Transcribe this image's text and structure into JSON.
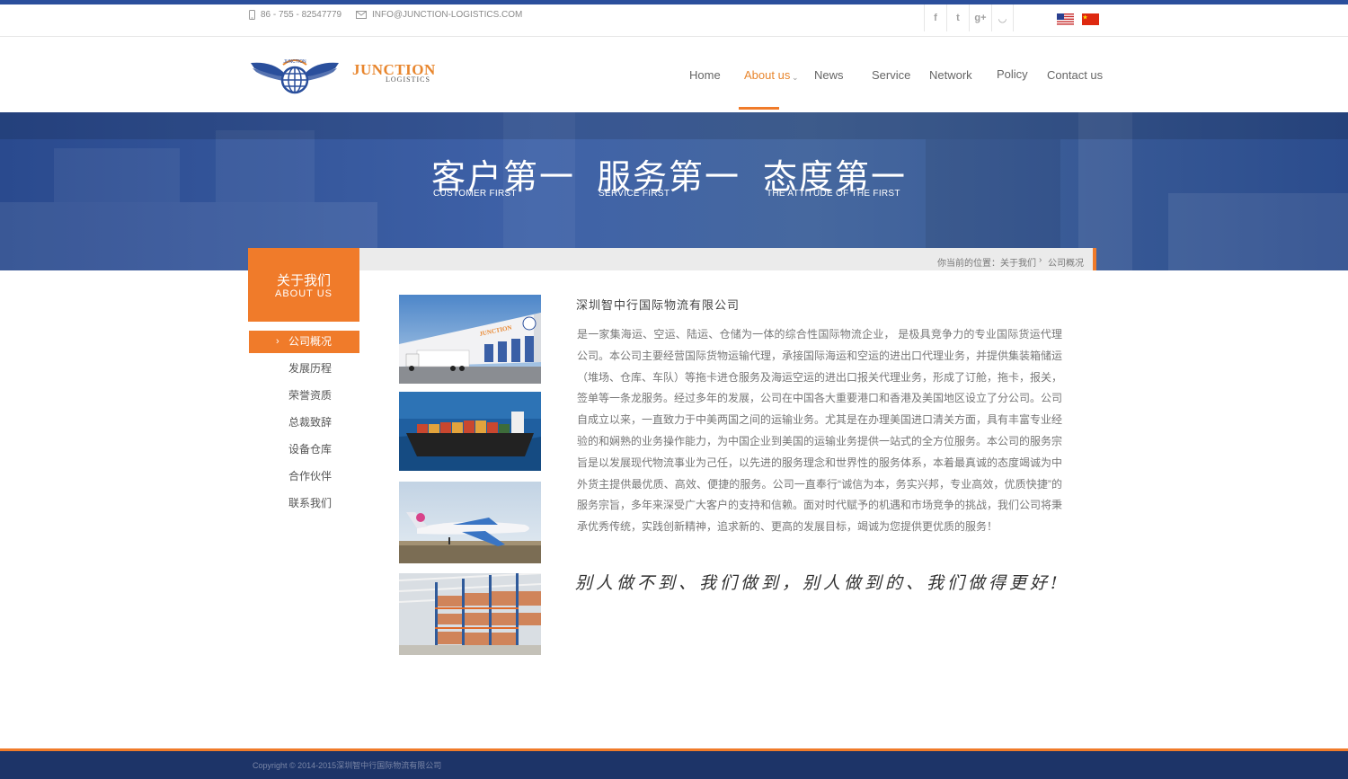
{
  "topbar": {
    "phone": "86 - 755 - 82547779",
    "email": "INFO@JUNCTION-LOGISTICS.COM",
    "socials": [
      {
        "icon": "facebook-icon",
        "glyph": "f"
      },
      {
        "icon": "twitter-icon",
        "glyph": "t"
      },
      {
        "icon": "google-plus-icon",
        "glyph": "g+"
      },
      {
        "icon": "rss-icon",
        "glyph": "◡"
      }
    ]
  },
  "logo": {
    "name": "JUNCTION",
    "sub": "LOGISTICS",
    "badge": "JUNCTION"
  },
  "nav": {
    "items": [
      {
        "label": "Home"
      },
      {
        "label": "About us",
        "active": true
      },
      {
        "label": "News"
      },
      {
        "label": "Service"
      },
      {
        "label": "Network"
      },
      {
        "label": "Policy"
      },
      {
        "label": "Contact us"
      }
    ]
  },
  "banner": {
    "slogans": [
      {
        "cn": "客户第一",
        "en": "CUSTOMER FIRST"
      },
      {
        "cn": "服务第一",
        "en": "SERVICE FIRST"
      },
      {
        "cn": "态度第一",
        "en": "THE ATTITUDE OF THE FIRST"
      }
    ]
  },
  "breadcrumb": {
    "prefix": "你当前的位置：",
    "items": [
      "关于我们",
      "公司概况"
    ]
  },
  "sidebar": {
    "title_cn": "关于我们",
    "title_en": "ABOUT US",
    "items": [
      {
        "label": "公司概况",
        "active": true
      },
      {
        "label": "发展历程"
      },
      {
        "label": "荣誉资质"
      },
      {
        "label": "总裁致辞"
      },
      {
        "label": "设备仓库"
      },
      {
        "label": "合作伙伴"
      },
      {
        "label": "联系我们"
      }
    ]
  },
  "content": {
    "company": "深圳智中行国际物流有限公司",
    "paragraph": "是一家集海运、空运、陆运、仓储为一体的综合性国际物流企业， 是极具竞争力的专业国际货运代理公司。本公司主要经营国际货物运输代理，承接国际海运和空运的进出口代理业务，并提供集装箱储运（堆场、仓库、车队）等拖卡进仓服务及海运空运的进出口报关代理业务，形成了订舱，拖卡，报关，签单等一条龙服务。经过多年的发展，公司在中国各大重要港口和香港及美国地区设立了分公司。公司自成立以来，一直致力于中美两国之间的运输业务。尤其是在办理美国进口清关方面，具有丰富专业经验的和娴熟的业务操作能力，为中国企业到美国的运输业务提供一站式的全方位服务。本公司的服务宗旨是以发展现代物流事业为己任，以先进的服务理念和世界性的服务体系，本着最真诚的态度竭诚为中外货主提供最优质、高效、便捷的服务。公司一直奉行“诚信为本，务实兴邦，专业高效，优质快捷”的服务宗旨，多年来深受广大客户的支持和信赖。面对时代赋予的机遇和市场竞争的挑战，我们公司将秉承优秀传统，实践创新精神，追求新的、更高的发展目标，竭诚为您提供更优质的服务！",
    "motto": "别人做不到、我们做到，别人做到的、我们做得更好!",
    "truck_label": "JUNCTION"
  },
  "footer": {
    "copyright": "Copyright © 2014-2015深圳智中行国际物流有限公司"
  },
  "colors": {
    "accent": "#f07b2a",
    "navy": "#1d3468",
    "brand_blue": "#2b4f9c"
  }
}
